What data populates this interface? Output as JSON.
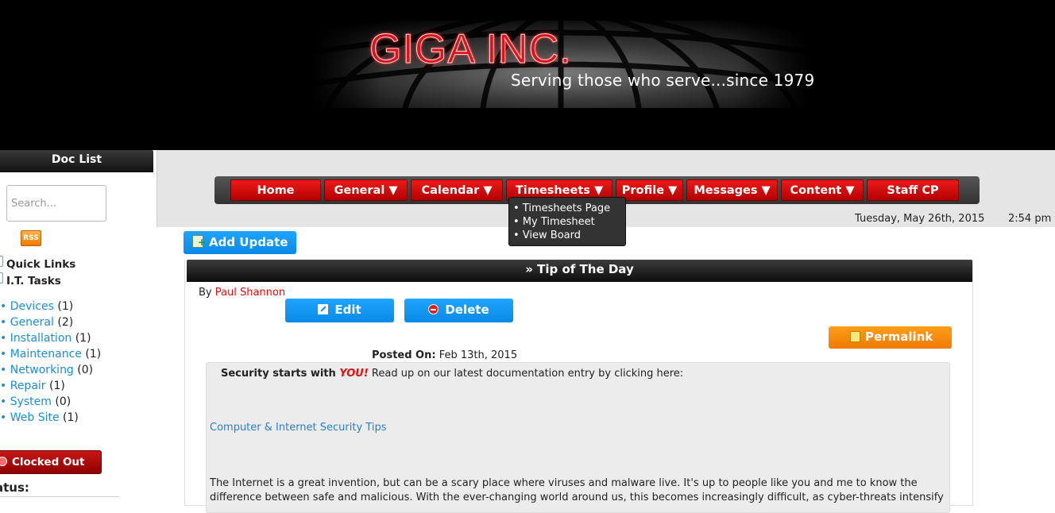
{
  "banner": {
    "logo": "GIGA INC.",
    "tagline": "Serving those who serve...since 1979"
  },
  "sidebar": {
    "title": "Doc List",
    "search_placeholder": "Search...",
    "rss_label": "RSS",
    "quick_links": "Quick Links",
    "it_tasks": "I.T. Tasks",
    "categories": [
      {
        "name": "Devices",
        "count": "(1)"
      },
      {
        "name": "General",
        "count": "(2)"
      },
      {
        "name": "Installation",
        "count": "(1)"
      },
      {
        "name": "Maintenance",
        "count": "(1)"
      },
      {
        "name": "Networking",
        "count": "(0)"
      },
      {
        "name": "Repair",
        "count": "(1)"
      },
      {
        "name": "System",
        "count": "(0)"
      },
      {
        "name": "Web Site",
        "count": "(1)"
      }
    ],
    "clocked_out": "Clocked Out",
    "status_label": "atus:"
  },
  "nav": {
    "items": [
      "Home",
      "General ▼",
      "Calendar ▼",
      "Timesheets ▼",
      "Profile ▼",
      "Messages ▼",
      "Content ▼",
      "Staff CP"
    ],
    "dropdown": [
      "• Timesheets Page",
      "• My Timesheet",
      "• View Board"
    ]
  },
  "datetime": {
    "date": "Tuesday, May 26th, 2015",
    "time": "2:54 pm"
  },
  "actions": {
    "add_update": "Add Update"
  },
  "post": {
    "header": "» Tip of The Day",
    "by_prefix": "By ",
    "author": "Paul Shannon",
    "edit_label": "Edit",
    "delete_label": "Delete",
    "permalink_label": "Permalink",
    "posted_label": "Posted On:",
    "posted_date": " Feb 13th, 2015",
    "tip_strong": "Security starts with ",
    "tip_you": "YOU!",
    "tip_rest": " Read up on our latest documentation entry by clicking here:",
    "link_text": "Computer & Internet Security Tips",
    "paragraph": "The Internet is a great invention, but can be a scary place where viruses and malware live. It's up to people like you and me to know the difference between safe and malicious. With the ever-changing world around us, this becomes increasingly difficult, as cyber-threats intensify"
  },
  "colors": {
    "brand_red": "#d8141a",
    "nav_red": "#cc0000",
    "accent_blue": "#0a8ae8",
    "accent_orange": "#f07a00",
    "link_blue": "#1a8fd6"
  }
}
